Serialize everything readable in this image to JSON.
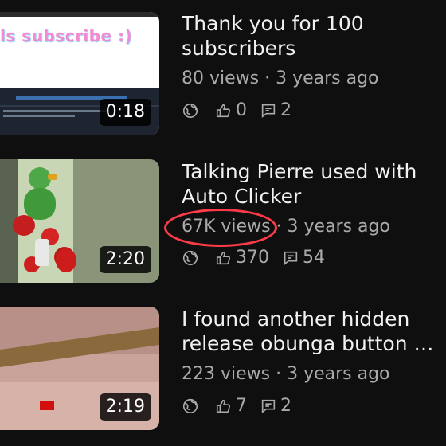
{
  "videos": [
    {
      "title_line1": "Thank you for 100",
      "title_line2": "subscribers",
      "meta": "80 views · 3 years ago",
      "likes": "0",
      "comments": "2",
      "duration": "0:18",
      "thumb_text": "ls subscribe :)"
    },
    {
      "title_line1": "Talking Pierre used with",
      "title_line2": "Auto Clicker",
      "views": "67K views",
      "sep_age": "· 3 years ago",
      "likes": "370",
      "comments": "54",
      "duration": "2:20"
    },
    {
      "title_line1": "I found another hidden",
      "title_line2": "release obunga button bot...",
      "meta": "223 views · 3 years ago",
      "likes": "7",
      "comments": "2",
      "duration": "2:19"
    }
  ],
  "colors": {
    "background": "#0f0f0f",
    "text_primary": "#f1f1f1",
    "text_secondary": "#aaaaaa",
    "annotation": "#ff3b4a"
  },
  "icons": [
    "globe-icon",
    "thumbs-up-icon",
    "comment-icon"
  ]
}
